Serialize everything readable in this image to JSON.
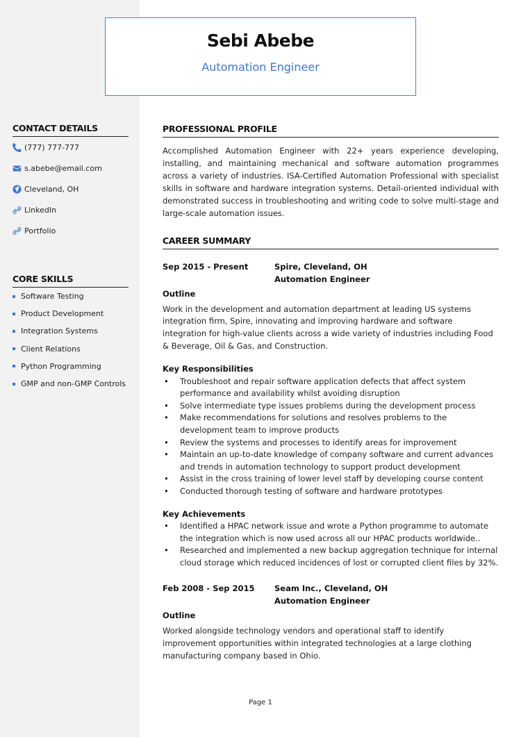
{
  "header": {
    "name": "Sebi Abebe",
    "title": "Automation Engineer",
    "accent_color": "#3d78d0"
  },
  "sidebar": {
    "contact": {
      "heading": "CONTACT DETAILS",
      "items": [
        {
          "icon": "phone-icon",
          "text": "(777) 777-777"
        },
        {
          "icon": "envelope-icon",
          "text": "s.abebe@email.com"
        },
        {
          "icon": "globe-icon",
          "text": "Cleveland, OH"
        },
        {
          "icon": "link-icon",
          "text": "LinkedIn"
        },
        {
          "icon": "link-icon",
          "text": "Portfolio"
        }
      ]
    },
    "skills": {
      "heading": "CORE SKILLS",
      "items": [
        "Software Testing",
        "Product Development",
        "Integration Systems",
        "Client Relations",
        "Python Programming",
        "GMP and non-GMP Controls"
      ]
    }
  },
  "profile": {
    "heading": "PROFESSIONAL PROFILE",
    "text": "Accomplished Automation Engineer with 22+ years experience developing, installing, and maintaining mechanical and software automation programmes across a variety of industries. ISA-Certified Automation Professional with specialist skills in software and hardware integration systems. Detail-oriented individual with demonstrated success in troubleshooting and writing code to solve multi-stage and large-scale automation issues."
  },
  "career": {
    "heading": "CAREER SUMMARY",
    "jobs": [
      {
        "dates": "Sep 2015 - Present",
        "company": "Spire, Cleveland, OH",
        "role": "Automation Engineer",
        "outline_label": "Outline",
        "outline": "Work in the development and automation department at leading US systems integration firm, Spire, innovating and improving hardware and software integration for high-value clients across a wide variety of industries including Food & Beverage, Oil & Gas, and Construction.",
        "responsibilities_label": "Key Responsibilities",
        "responsibilities": [
          "Troubleshoot and repair software application defects that affect system performance and availability whilst avoiding disruption",
          "Solve intermediate type issues problems during the development process",
          "Make recommendations for solutions and resolves problems to the development team to improve products",
          "Review the systems and processes to identify areas for improvement",
          "Maintain an up-to-date knowledge of company software and current advances and trends in automation technology to support product development",
          "Assist in the cross training of lower level staff by developing course content",
          "Conducted thorough testing of software and hardware prototypes"
        ],
        "achievements_label": "Key Achievements",
        "achievements": [
          "Identified a HPAC network issue and wrote a Python programme to automate the integration which is now used across all our HPAC products worldwide..",
          "Researched and implemented a new backup aggregation technique for internal cloud storage which reduced incidences of lost or corrupted client files by 32%."
        ]
      },
      {
        "dates": "Feb 2008 - Sep 2015",
        "company": "Seam Inc., Cleveland, OH",
        "role": "Automation Engineer",
        "outline_label": "Outline",
        "outline": "Worked alongside technology vendors and operational staff to identify improvement opportunities within integrated technologies at a large clothing manufacturing company based in Ohio."
      }
    ]
  },
  "footer": {
    "page": "Page 1"
  }
}
